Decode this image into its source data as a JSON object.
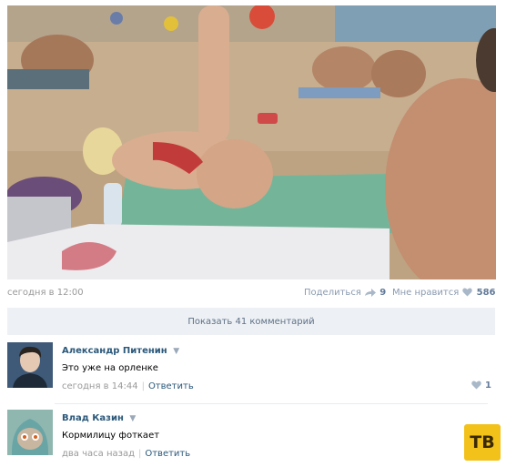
{
  "post": {
    "time": "сегодня в 12:00",
    "share_label": "Поделиться",
    "share_count": "9",
    "like_label": "Мне нравится",
    "like_count": "586"
  },
  "show_comments": "Показать 41 комментарий",
  "comments": [
    {
      "author": "Александр Питенин",
      "caret": "▼",
      "text": "Это уже на орленке",
      "time": "сегодня в 14:44",
      "separator": "|",
      "reply": "Ответить",
      "likes": "1"
    },
    {
      "author": "Влад Казин",
      "caret": "▼",
      "text": "Кормилицу фоткает",
      "time": "два часа назад",
      "separator": "|",
      "reply": "Ответить"
    }
  ],
  "watermark": "ТВ",
  "colors": {
    "link": "#2b587a",
    "muted": "#999999",
    "bar_bg": "#edf1f5",
    "badge": "#f2c21b"
  },
  "icons": [
    "share-icon",
    "heart-icon"
  ]
}
